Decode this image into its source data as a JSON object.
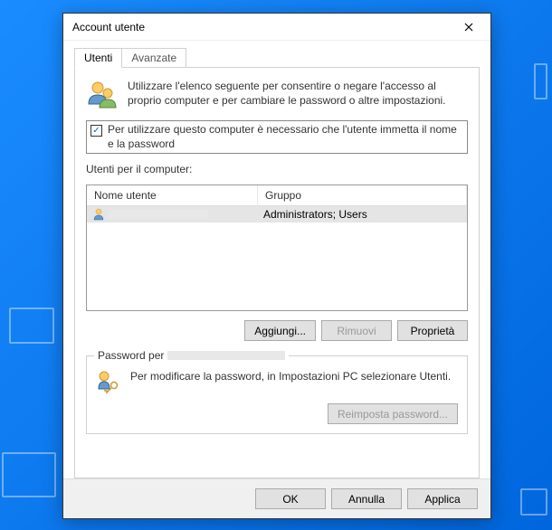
{
  "window": {
    "title": "Account utente"
  },
  "tabs": {
    "users": "Utenti",
    "advanced": "Avanzate"
  },
  "intro": "Utilizzare l'elenco seguente per consentire o negare l'accesso al proprio computer e per cambiare le password o altre impostazioni.",
  "checkbox": {
    "checked": true,
    "label": "Per utilizzare questo computer è necessario che l'utente immetta il nome e la password"
  },
  "list_label": "Utenti per il computer:",
  "columns": {
    "username": "Nome utente",
    "group": "Gruppo"
  },
  "rows": [
    {
      "username": "",
      "group": "Administrators; Users"
    }
  ],
  "buttons": {
    "add": "Aggiungi...",
    "remove": "Rimuovi",
    "properties": "Proprietà"
  },
  "password_group": {
    "label_prefix": "Password per",
    "text": "Per modificare la password, in Impostazioni PC selezionare Utenti.",
    "reset_btn": "Reimposta password..."
  },
  "footer": {
    "ok": "OK",
    "cancel": "Annulla",
    "apply": "Applica"
  }
}
